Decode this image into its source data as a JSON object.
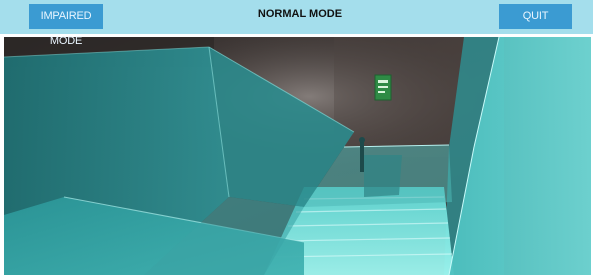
{
  "top_bar": {
    "impaired_label": "IMPAIRED MODE",
    "mode_title": "NORMAL MODE",
    "quit_label": "QUIT"
  },
  "scene": {
    "exit_sign_icon": "emergency-exit-sign-icon",
    "figure_icon": "person-figure-icon"
  },
  "colors": {
    "top_bar": "#a4deec",
    "button": "#3b9bd2",
    "button_text": "#eaf6ff",
    "title_text": "#111111",
    "wall_dark": "#3a3533",
    "glass_teal": "#2a9c9c",
    "stair_glow": "#7ff0ee",
    "exit_sign": "#2e8b45"
  }
}
